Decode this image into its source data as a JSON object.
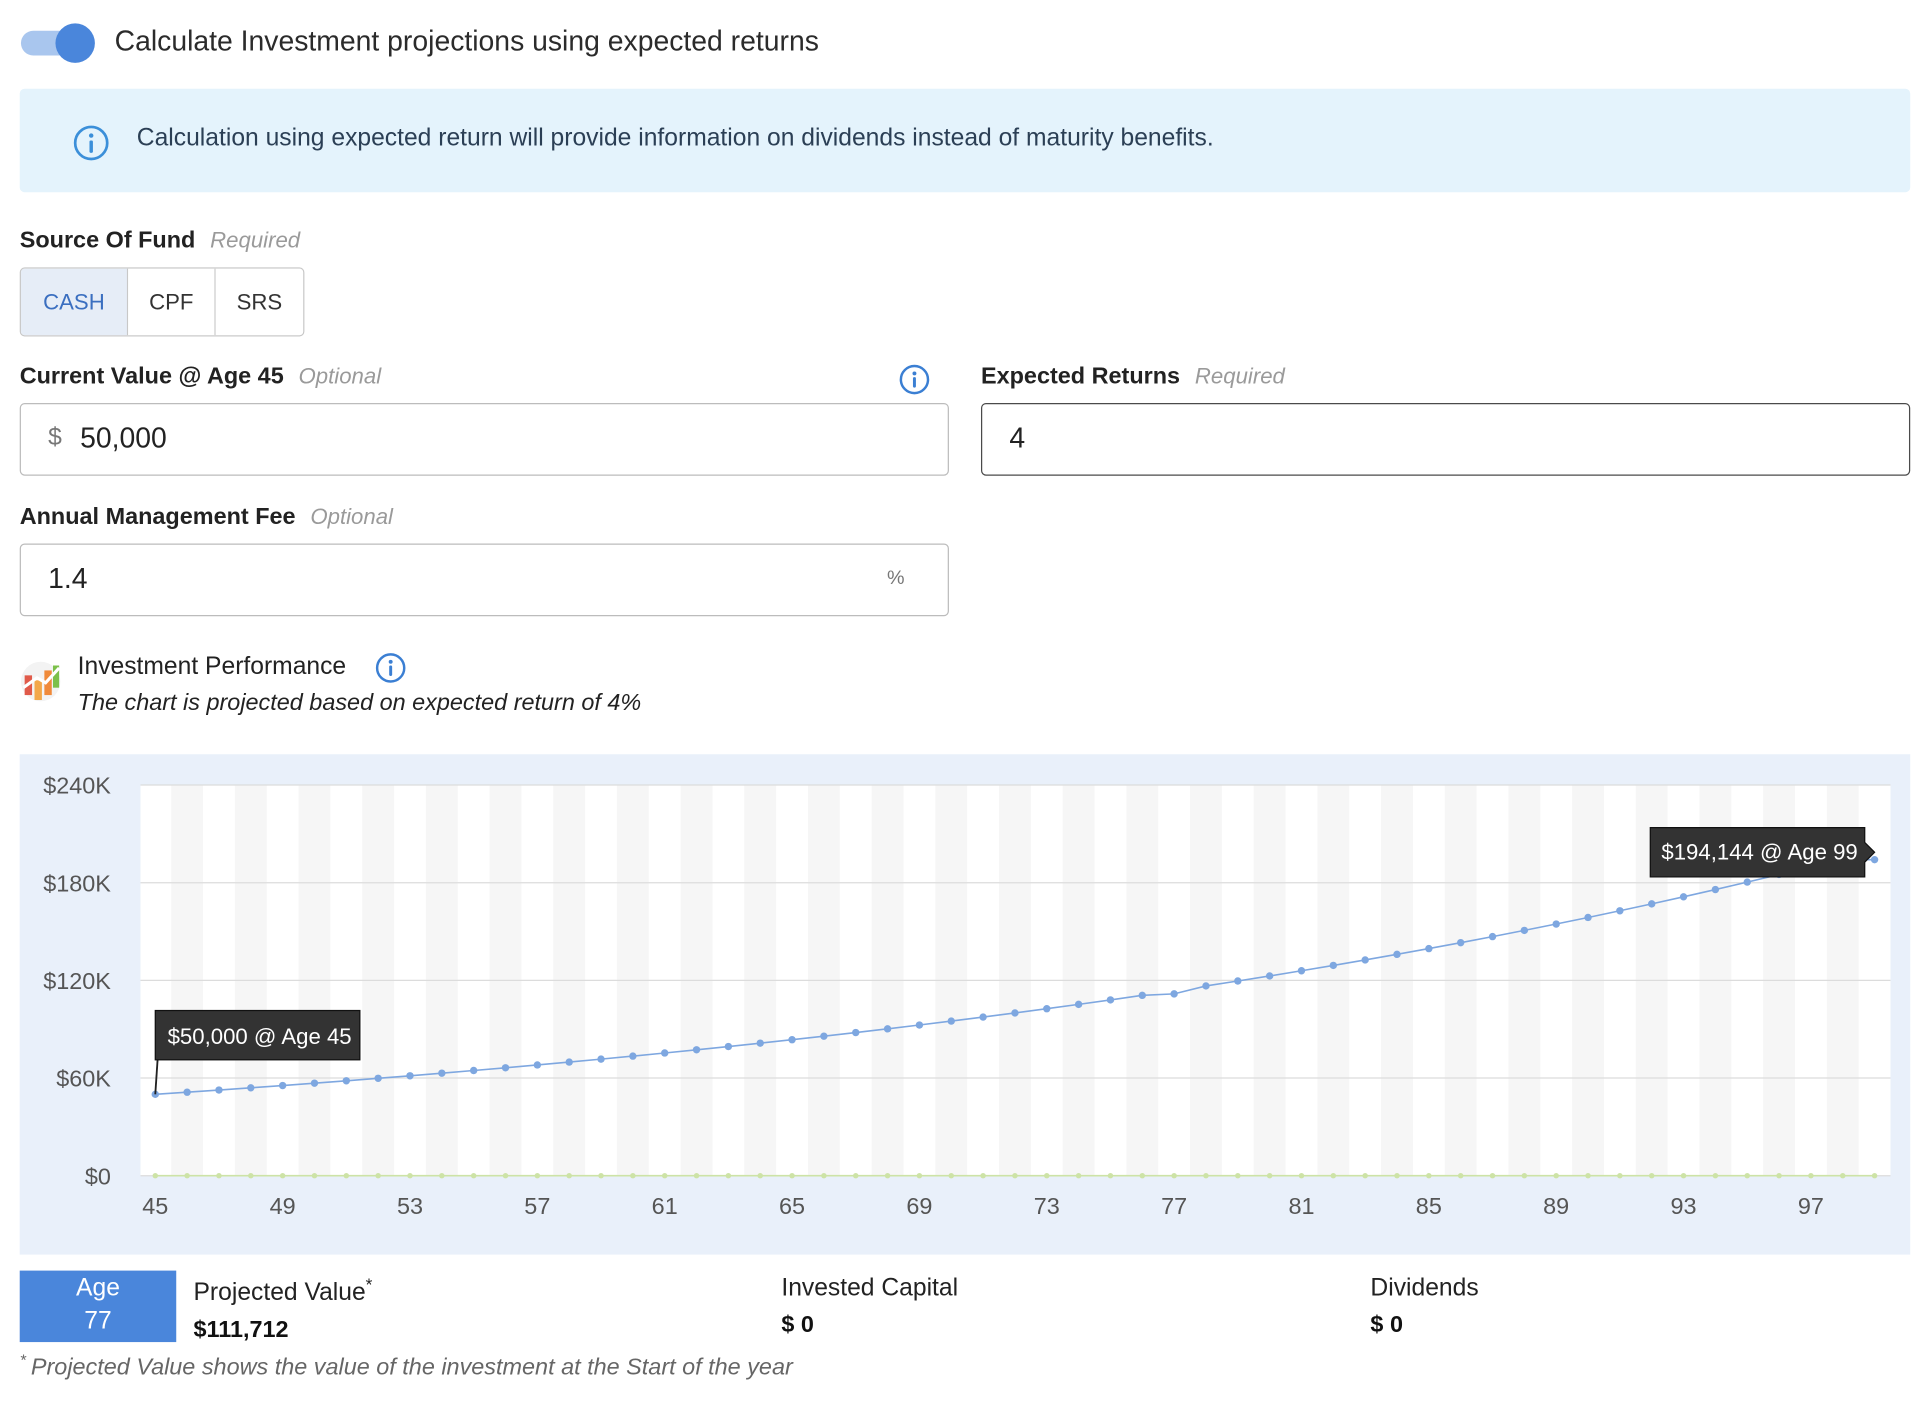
{
  "toggle": {
    "label": "Calculate Investment projections using expected returns",
    "on": true
  },
  "banner": {
    "icon": "info-icon",
    "text": "Calculation using expected return will provide information on dividends instead of maturity benefits."
  },
  "source_of_fund": {
    "label": "Source Of Fund",
    "hint": "Required",
    "options": [
      "CASH",
      "CPF",
      "SRS"
    ],
    "selected": "CASH"
  },
  "current_value": {
    "label": "Current Value @ Age 45",
    "hint": "Optional",
    "prefix": "$",
    "value": "50,000"
  },
  "expected_returns": {
    "label": "Expected Returns",
    "hint": "Required",
    "value": "4"
  },
  "management_fee": {
    "label": "Annual Management Fee",
    "hint": "Optional",
    "value": "1.4",
    "suffix": "%"
  },
  "performance": {
    "title": "Investment Performance",
    "subtitle": "The chart is projected based on expected return of 4%"
  },
  "chart_data": {
    "type": "line",
    "title": "",
    "xlabel": "",
    "ylabel": "",
    "x": [
      45,
      46,
      47,
      48,
      49,
      50,
      51,
      52,
      53,
      54,
      55,
      56,
      57,
      58,
      59,
      60,
      61,
      62,
      63,
      64,
      65,
      66,
      67,
      68,
      69,
      70,
      71,
      72,
      73,
      74,
      75,
      76,
      77,
      78,
      79,
      80,
      81,
      82,
      83,
      84,
      85,
      86,
      87,
      88,
      89,
      90,
      91,
      92,
      93,
      94,
      95,
      96,
      97,
      98,
      99
    ],
    "x_ticks": [
      "45",
      "49",
      "53",
      "57",
      "61",
      "65",
      "69",
      "73",
      "77",
      "81",
      "85",
      "89",
      "93",
      "97"
    ],
    "y_ticks": [
      "$0",
      "$60K",
      "$120K",
      "$180K",
      "$240K"
    ],
    "ylim": [
      0,
      240000
    ],
    "series": [
      {
        "color": "#7ea7e0",
        "values": [
          50000,
          51300,
          52634,
          54002,
          55406,
          56847,
          58325,
          59842,
          61398,
          62994,
          64632,
          66312,
          68036,
          69805,
          71620,
          73482,
          75393,
          77353,
          79364,
          81428,
          83545,
          85717,
          87946,
          90232,
          92578,
          94985,
          97455,
          99989,
          102588,
          105256,
          107993,
          110801,
          111712,
          116586,
          119617,
          122727,
          125918,
          129192,
          132551,
          135997,
          139533,
          143161,
          146883,
          150702,
          154621,
          158641,
          162766,
          166998,
          171340,
          175795,
          180366,
          185056,
          189867,
          194144,
          194144
        ]
      },
      {
        "color": "#cde3a6",
        "values": [
          0,
          0,
          0,
          0,
          0,
          0,
          0,
          0,
          0,
          0,
          0,
          0,
          0,
          0,
          0,
          0,
          0,
          0,
          0,
          0,
          0,
          0,
          0,
          0,
          0,
          0,
          0,
          0,
          0,
          0,
          0,
          0,
          0,
          0,
          0,
          0,
          0,
          0,
          0,
          0,
          0,
          0,
          0,
          0,
          0,
          0,
          0,
          0,
          0,
          0,
          0,
          0,
          0,
          0,
          0
        ]
      }
    ],
    "annotations": [
      {
        "text": "$50,000 @ Age 45",
        "x": 45,
        "y": 50000
      },
      {
        "text": "$194,144 @ Age 99",
        "x": 99,
        "y": 194144
      }
    ],
    "grid": true,
    "legend": "none"
  },
  "summary": {
    "age_label": "Age",
    "age_value": "77",
    "projected_label": "Projected Value",
    "projected_mark": "*",
    "projected_value": "$111,712",
    "capital_label": "Invested Capital",
    "capital_value": "$ 0",
    "dividends_label": "Dividends",
    "dividends_value": "$ 0"
  },
  "footnote": {
    "mark": "*",
    "text": "Projected Value shows the value of the investment at the Start of the year"
  }
}
